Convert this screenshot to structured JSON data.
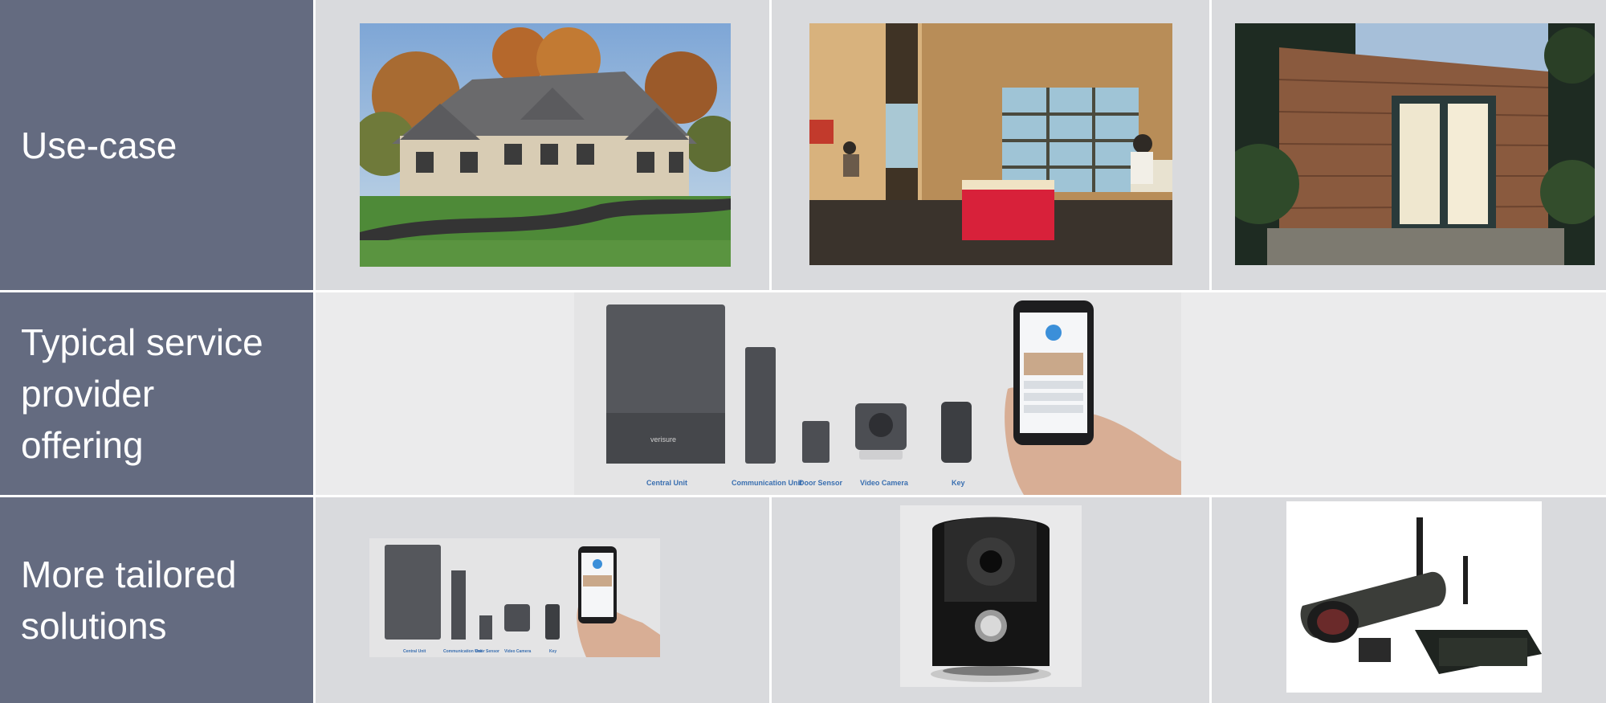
{
  "rows": [
    {
      "label": "Use-case"
    },
    {
      "label": "Typical service\nprovider\noffering"
    },
    {
      "label": "More tailored\nsolutions"
    }
  ],
  "use_case_images": [
    {
      "name": "house-photo"
    },
    {
      "name": "dorm-room-photo"
    },
    {
      "name": "garden-office-photo"
    }
  ],
  "product_captions": [
    "Central Unit",
    "Communication Unit",
    "Door Sensor",
    "Video Camera",
    "Key"
  ],
  "brand_mark": "verisure",
  "colors": {
    "label_bg": "#646b80",
    "cell_bg": "#d9dadd",
    "caption": "#3a6fb0"
  }
}
